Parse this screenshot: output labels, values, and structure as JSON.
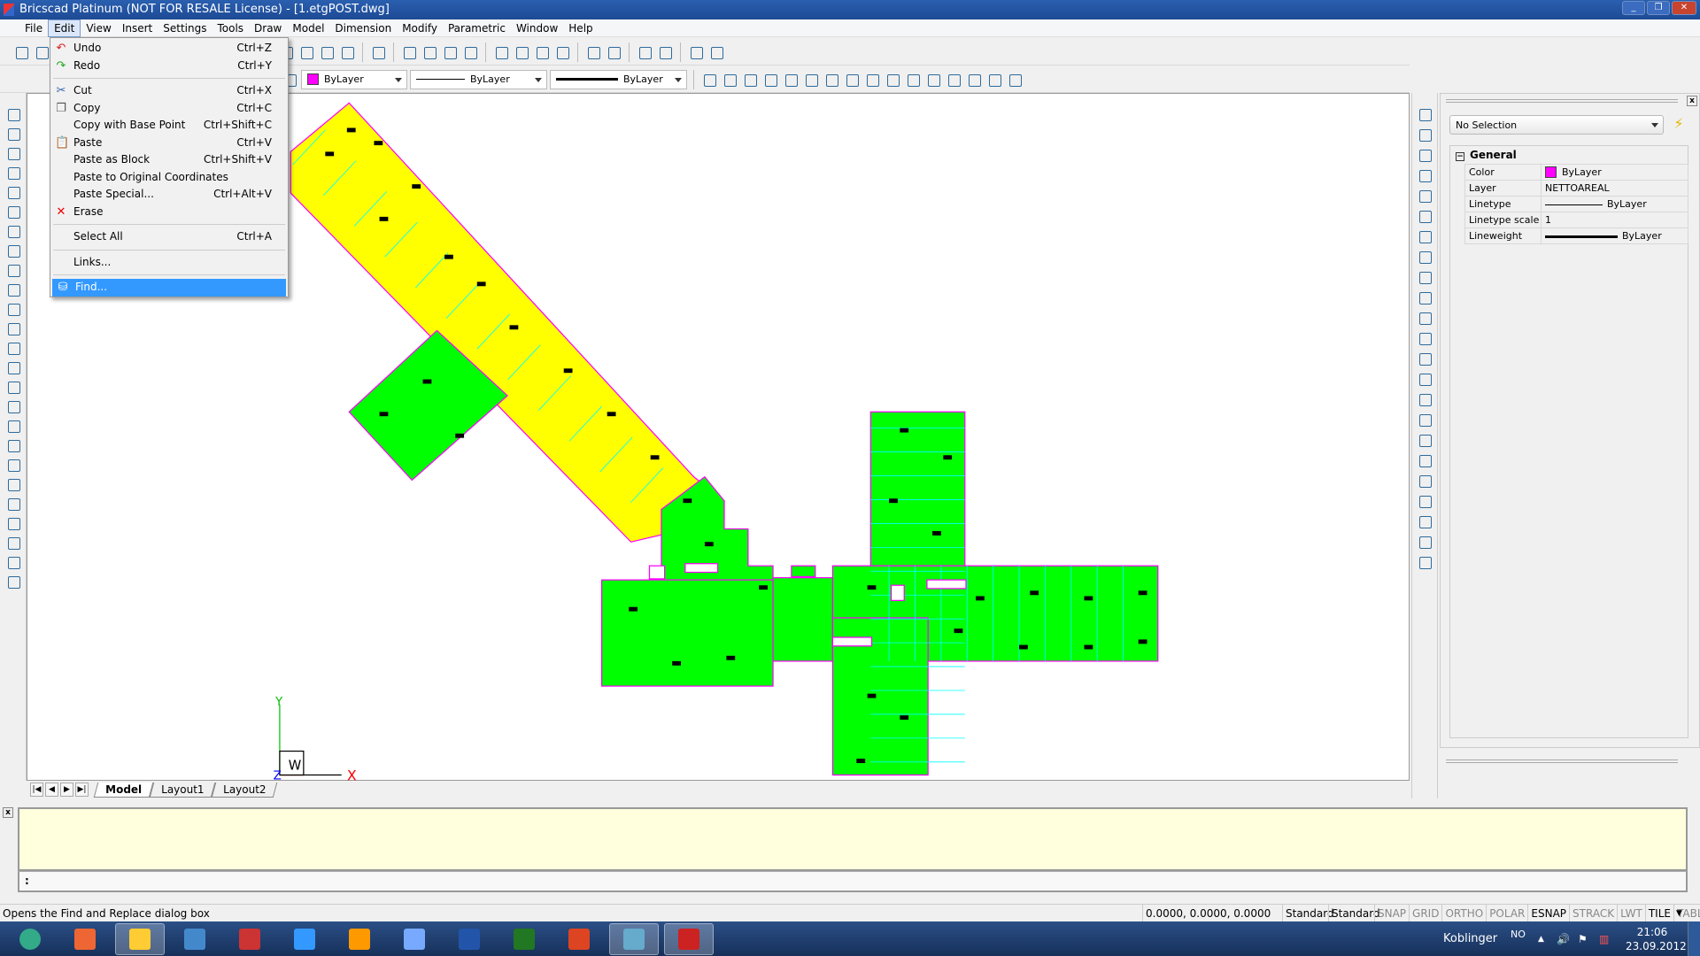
{
  "window": {
    "title": "Bricscad Platinum (NOT FOR RESALE License) - [1.etgPOST.dwg]",
    "controls": [
      "minimize",
      "restore",
      "close"
    ]
  },
  "menubar": {
    "items": [
      "File",
      "Edit",
      "View",
      "Insert",
      "Settings",
      "Tools",
      "Draw",
      "Model",
      "Dimension",
      "Modify",
      "Parametric",
      "Window",
      "Help"
    ],
    "active": "Edit"
  },
  "edit_menu": {
    "items": [
      {
        "label": "Undo",
        "shortcut": "Ctrl+Z",
        "icon": "undo-icon"
      },
      {
        "label": "Redo",
        "shortcut": "Ctrl+Y",
        "icon": "redo-icon"
      },
      {
        "sep": true
      },
      {
        "label": "Cut",
        "shortcut": "Ctrl+X",
        "icon": "scissors-icon"
      },
      {
        "label": "Copy",
        "shortcut": "Ctrl+C",
        "icon": "copy-icon"
      },
      {
        "label": "Copy with Base Point",
        "shortcut": "Ctrl+Shift+C"
      },
      {
        "label": "Paste",
        "shortcut": "Ctrl+V",
        "icon": "paste-icon"
      },
      {
        "label": "Paste as Block",
        "shortcut": "Ctrl+Shift+V"
      },
      {
        "label": "Paste to Original Coordinates",
        "shortcut": ""
      },
      {
        "label": "Paste Special...",
        "shortcut": "Ctrl+Alt+V"
      },
      {
        "label": "Erase",
        "shortcut": "",
        "icon": "erase-x-icon"
      },
      {
        "sep": true
      },
      {
        "label": "Select All",
        "shortcut": "Ctrl+A"
      },
      {
        "sep": true
      },
      {
        "label": "Links...",
        "shortcut": ""
      },
      {
        "sep": true
      },
      {
        "label": "Find...",
        "shortcut": "",
        "icon": "binoculars-icon",
        "highlighted": true
      }
    ]
  },
  "toolbar1": {
    "icons": [
      "new-icon",
      "open-icon",
      "spacer",
      "properties-icon",
      "settings-icon",
      "layers-icon",
      "help-icon",
      "sep",
      "pencil-icon",
      "sep",
      "zoom-in-icon",
      "zoom-out-icon",
      "zoom-window-icon",
      "zoom-previous-icon",
      "sep",
      "orbit-icon",
      "look-icon",
      "ucs-icon",
      "view-icon",
      "sep",
      "box-icon",
      "render-icon",
      "sep",
      "tile-vertical-icon",
      "tile-horizontal-icon",
      "sep",
      "blocks-icon",
      "attach-icon"
    ]
  },
  "toolbar2": {
    "color": "ByLayer",
    "linetype": "ByLayer",
    "lineweight": "ByLayer",
    "color_swatch": "#ff00ff",
    "snap_icons": [
      "snap-endpoint-icon",
      "snap-midpoint-icon",
      "snap-intersection-icon",
      "snap-center-icon",
      "snap-perpendicular-icon",
      "snap-parallel-icon",
      "snap-tangent-icon",
      "snap-quadrant-icon",
      "snap-insertion-icon",
      "snap-node-icon",
      "snap-none-icon",
      "snap-clear-icon",
      "snap-nearest-icon",
      "snap-off-icon",
      "snap-track-icon",
      "snap-extension-icon"
    ]
  },
  "left_toolbar": {
    "icons": [
      "line-icon",
      "arc-icon",
      "rectangle-icon",
      "circle-arc-icon",
      "circle-icon",
      "donut-icon",
      "spline-icon",
      "ellipse-icon",
      "point-icon",
      "region-icon",
      "hatch-icon",
      "boundary-icon",
      "polygon-icon",
      "wipeout-icon",
      "cloud-icon",
      "table-icon",
      "text-icon",
      "mtext-icon",
      "insert-block-icon",
      "make-block-icon",
      "xref-icon",
      "image-icon",
      "attach-image-icon",
      "printer-icon",
      "attribute-icon"
    ]
  },
  "right_toolbar": {
    "icons": [
      "move-icon",
      "copy-objects-icon",
      "offset-icon",
      "array-rect-icon",
      "rotate-icon",
      "rotate3d-icon",
      "mirror-icon",
      "mirror3d-icon",
      "array-icon",
      "explode-icon",
      "scale-icon",
      "stretch-icon",
      "trim-icon",
      "extend-icon",
      "break-icon",
      "join-icon",
      "chamfer-icon",
      "fillet-icon",
      "edit-polyline-icon",
      "edit-spline-icon",
      "match-properties-icon",
      "solid-edit-icon",
      "paint-icon"
    ]
  },
  "drawing_tabs": {
    "tabs": [
      "Model",
      "Layout1",
      "Layout2"
    ],
    "active": "Model"
  },
  "ucs": {
    "x": "X",
    "y": "Y",
    "z": "Z",
    "w": "W"
  },
  "properties": {
    "selection": "No Selection",
    "section": "General",
    "rows": [
      {
        "label": "Color",
        "value": "ByLayer",
        "swatch": "#ff00ff"
      },
      {
        "label": "Layer",
        "value": "NETTOAREAL"
      },
      {
        "label": "Linetype",
        "value": "ByLayer",
        "line": "thin"
      },
      {
        "label": "Linetype scale",
        "value": "1"
      },
      {
        "label": "Lineweight",
        "value": "ByLayer",
        "line": "thick"
      }
    ]
  },
  "command": {
    "prompt": ":"
  },
  "status": {
    "message": "Opens the Find and Replace dialog box",
    "coords": "0.0000, 0.0000, 0.0000",
    "style1": "Standard",
    "style2": "Standard",
    "toggles": [
      {
        "label": "SNAP",
        "on": false
      },
      {
        "label": "GRID",
        "on": false
      },
      {
        "label": "ORTHO",
        "on": false
      },
      {
        "label": "POLAR",
        "on": false
      },
      {
        "label": "ESNAP",
        "on": true
      },
      {
        "label": "STRACK",
        "on": false
      },
      {
        "label": "LWT",
        "on": false
      },
      {
        "label": "TILE",
        "on": true
      },
      {
        "label": "TABLET",
        "on": false
      }
    ]
  },
  "taskbar": {
    "apps": [
      "start-orb-icon",
      "media-player-icon",
      "explorer-icon",
      "outlook-express-icon",
      "pdf-icon",
      "ie-icon",
      "outlook-icon",
      "paint-icon",
      "word-icon",
      "excel-icon",
      "powerpoint-icon",
      "network-icon",
      "bricscad-icon"
    ],
    "user": "Koblinger",
    "lang": "NO",
    "time": "21:06",
    "date": "23.09.2012"
  },
  "colors": {
    "room_fill": "#00ff00",
    "corridor_fill": "#ffff00",
    "outline": "#ff00ff",
    "hatch": "#00ffff",
    "highlight": "#3399ff",
    "command_bg": "#ffffdd"
  }
}
